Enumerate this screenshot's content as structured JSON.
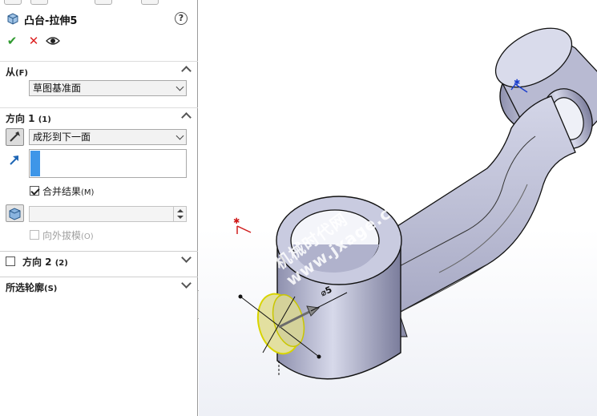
{
  "feature": {
    "title": "凸台-拉伸5",
    "help": "?"
  },
  "actions": {
    "ok": "✔",
    "cancel": "✕"
  },
  "from": {
    "title": "从",
    "hotkey": "(F)",
    "value": "草图基准面"
  },
  "direction1": {
    "title": "方向 1",
    "hotkey": "(1)",
    "end_condition": "成形到下一面",
    "merge_label": "合并结果",
    "merge_hotkey": "(M)",
    "merge_checked": true,
    "draft_label": "向外拔模",
    "draft_hotkey": "(O)"
  },
  "direction2": {
    "title": "方向 2",
    "hotkey": "(2)"
  },
  "contours": {
    "title": "所选轮廓",
    "hotkey": "(S)"
  },
  "viewport": {
    "dimension_label": "⌀5",
    "watermark_line1": "机械时代网",
    "watermark_line2": "www.jxage.com",
    "part_color": "#c9cbe0",
    "preview_color": "#e6e4a0"
  }
}
